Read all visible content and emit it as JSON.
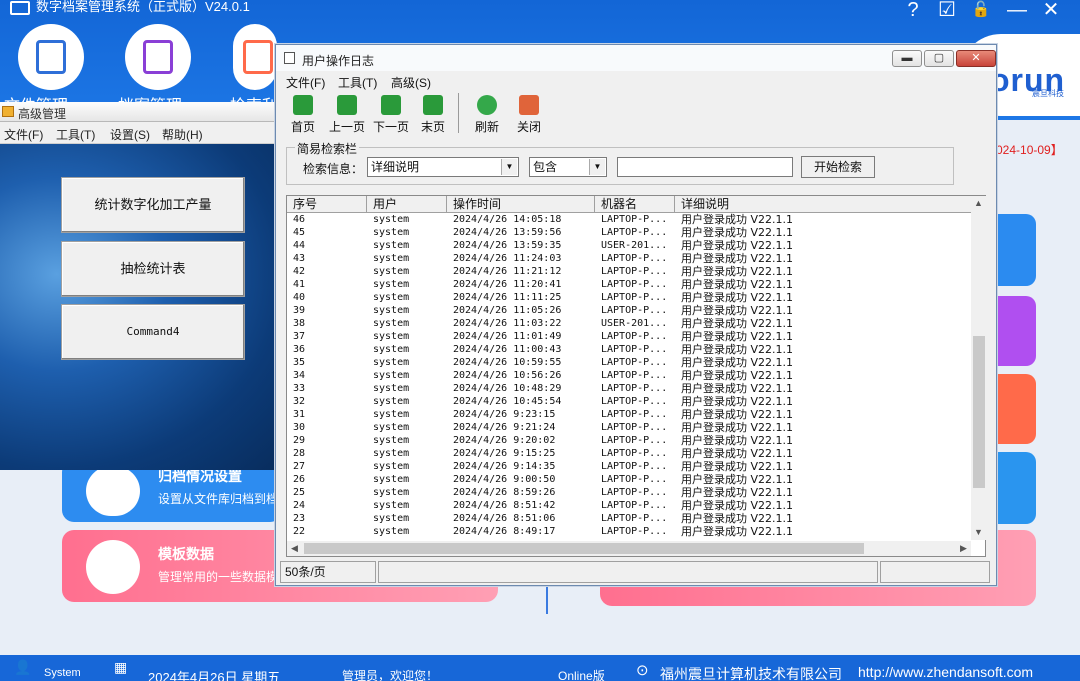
{
  "app": {
    "title": "数字档案管理系统（正式版）V24.0.1",
    "brand": "orun",
    "brand_sub": "震旦科技",
    "nav": [
      {
        "label": "文件管理",
        "icon": "file-manage-icon"
      },
      {
        "label": "档案管理",
        "icon": "archive-manage-icon"
      },
      {
        "label": "检索利",
        "icon": "search-manage-icon"
      }
    ],
    "controls": [
      "?",
      "☑",
      "🔓",
      "—",
      "✕"
    ],
    "date_red": "024-10-09】",
    "cards": {
      "archive_title": "归档情况设置",
      "archive_desc": "设置从文件库归档到档",
      "template_title": "模板数据",
      "template_desc": "管理常用的一些数据模"
    },
    "status": {
      "user": "System",
      "date": "2024年4月26日 星期五",
      "admin": "管理员，欢迎您！",
      "edition": "Online版",
      "company": "福州震旦计算机技术有限公司",
      "url": "http://www.zhendansoft.com"
    },
    "colors": {
      "header": "#1767d8",
      "blue_card": "#2b8bf0",
      "purple_card": "#b04ff0",
      "orange_card": "#ff6a4a",
      "pink_card": "#ff6f8f"
    }
  },
  "stats_window": {
    "title": "高级管理",
    "menu": [
      "文件(F)",
      "工具(T)",
      "设置(S)",
      "帮助(H)"
    ],
    "buttons": [
      "统计数字化加工产量",
      "抽检统计表",
      "Command4"
    ]
  },
  "log_window": {
    "title": "用户操作日志",
    "menu": [
      "文件(F)",
      "工具(T)",
      "高级(S)"
    ],
    "toolbar": [
      {
        "label": "首页",
        "icon": "first-page-icon",
        "color": "#2a9a3a"
      },
      {
        "label": "上一页",
        "icon": "prev-page-icon",
        "color": "#2a9a3a"
      },
      {
        "label": "下一页",
        "icon": "next-page-icon",
        "color": "#2a9a3a"
      },
      {
        "label": "末页",
        "icon": "last-page-icon",
        "color": "#2a9a3a"
      },
      {
        "label": "刷新",
        "icon": "refresh-icon",
        "color": "#34a84a"
      },
      {
        "label": "关闭",
        "icon": "close-door-icon",
        "color": "#e0643a"
      }
    ],
    "search": {
      "legend": "简易检索栏",
      "label": "检索信息：",
      "field": "详细说明",
      "operator": "包含",
      "value": "",
      "button": "开始检索"
    },
    "columns": [
      "序号",
      "用户",
      "操作时间",
      "机器名",
      "详细说明"
    ],
    "rows": [
      [
        "46",
        "system",
        "2024/4/26 14:05:18",
        "LAPTOP-P...",
        "用户登录成功 V22.1.1"
      ],
      [
        "45",
        "system",
        "2024/4/26 13:59:56",
        "LAPTOP-P...",
        "用户登录成功 V22.1.1"
      ],
      [
        "44",
        "system",
        "2024/4/26 13:59:35",
        "USER-201...",
        "用户登录成功 V22.1.1"
      ],
      [
        "43",
        "system",
        "2024/4/26 11:24:03",
        "LAPTOP-P...",
        "用户登录成功 V22.1.1"
      ],
      [
        "42",
        "system",
        "2024/4/26 11:21:12",
        "LAPTOP-P...",
        "用户登录成功 V22.1.1"
      ],
      [
        "41",
        "system",
        "2024/4/26 11:20:41",
        "LAPTOP-P...",
        "用户登录成功 V22.1.1"
      ],
      [
        "40",
        "system",
        "2024/4/26 11:11:25",
        "LAPTOP-P...",
        "用户登录成功 V22.1.1"
      ],
      [
        "39",
        "system",
        "2024/4/26 11:05:26",
        "LAPTOP-P...",
        "用户登录成功 V22.1.1"
      ],
      [
        "38",
        "system",
        "2024/4/26 11:03:22",
        "USER-201...",
        "用户登录成功 V22.1.1"
      ],
      [
        "37",
        "system",
        "2024/4/26 11:01:49",
        "LAPTOP-P...",
        "用户登录成功 V22.1.1"
      ],
      [
        "36",
        "system",
        "2024/4/26 11:00:43",
        "LAPTOP-P...",
        "用户登录成功 V22.1.1"
      ],
      [
        "35",
        "system",
        "2024/4/26 10:59:55",
        "LAPTOP-P...",
        "用户登录成功 V22.1.1"
      ],
      [
        "34",
        "system",
        "2024/4/26 10:56:26",
        "LAPTOP-P...",
        "用户登录成功 V22.1.1"
      ],
      [
        "33",
        "system",
        "2024/4/26 10:48:29",
        "LAPTOP-P...",
        "用户登录成功 V22.1.1"
      ],
      [
        "32",
        "system",
        "2024/4/26 10:45:54",
        "LAPTOP-P...",
        "用户登录成功 V22.1.1"
      ],
      [
        "31",
        "system",
        "2024/4/26 9:23:15",
        "LAPTOP-P...",
        "用户登录成功 V22.1.1"
      ],
      [
        "30",
        "system",
        "2024/4/26 9:21:24",
        "LAPTOP-P...",
        "用户登录成功 V22.1.1"
      ],
      [
        "29",
        "system",
        "2024/4/26 9:20:02",
        "LAPTOP-P...",
        "用户登录成功 V22.1.1"
      ],
      [
        "28",
        "system",
        "2024/4/26 9:15:25",
        "LAPTOP-P...",
        "用户登录成功 V22.1.1"
      ],
      [
        "27",
        "system",
        "2024/4/26 9:14:35",
        "LAPTOP-P...",
        "用户登录成功 V22.1.1"
      ],
      [
        "26",
        "system",
        "2024/4/26 9:00:50",
        "LAPTOP-P...",
        "用户登录成功 V22.1.1"
      ],
      [
        "25",
        "system",
        "2024/4/26 8:59:26",
        "LAPTOP-P...",
        "用户登录成功 V22.1.1"
      ],
      [
        "24",
        "system",
        "2024/4/26 8:51:42",
        "LAPTOP-P...",
        "用户登录成功 V22.1.1"
      ],
      [
        "23",
        "system",
        "2024/4/26 8:51:06",
        "LAPTOP-P...",
        "用户登录成功 V22.1.1"
      ],
      [
        "22",
        "system",
        "2024/4/26 8:49:17",
        "LAPTOP-P...",
        "用户登录成功 V22.1.1"
      ]
    ],
    "page_size": "50条/页"
  }
}
